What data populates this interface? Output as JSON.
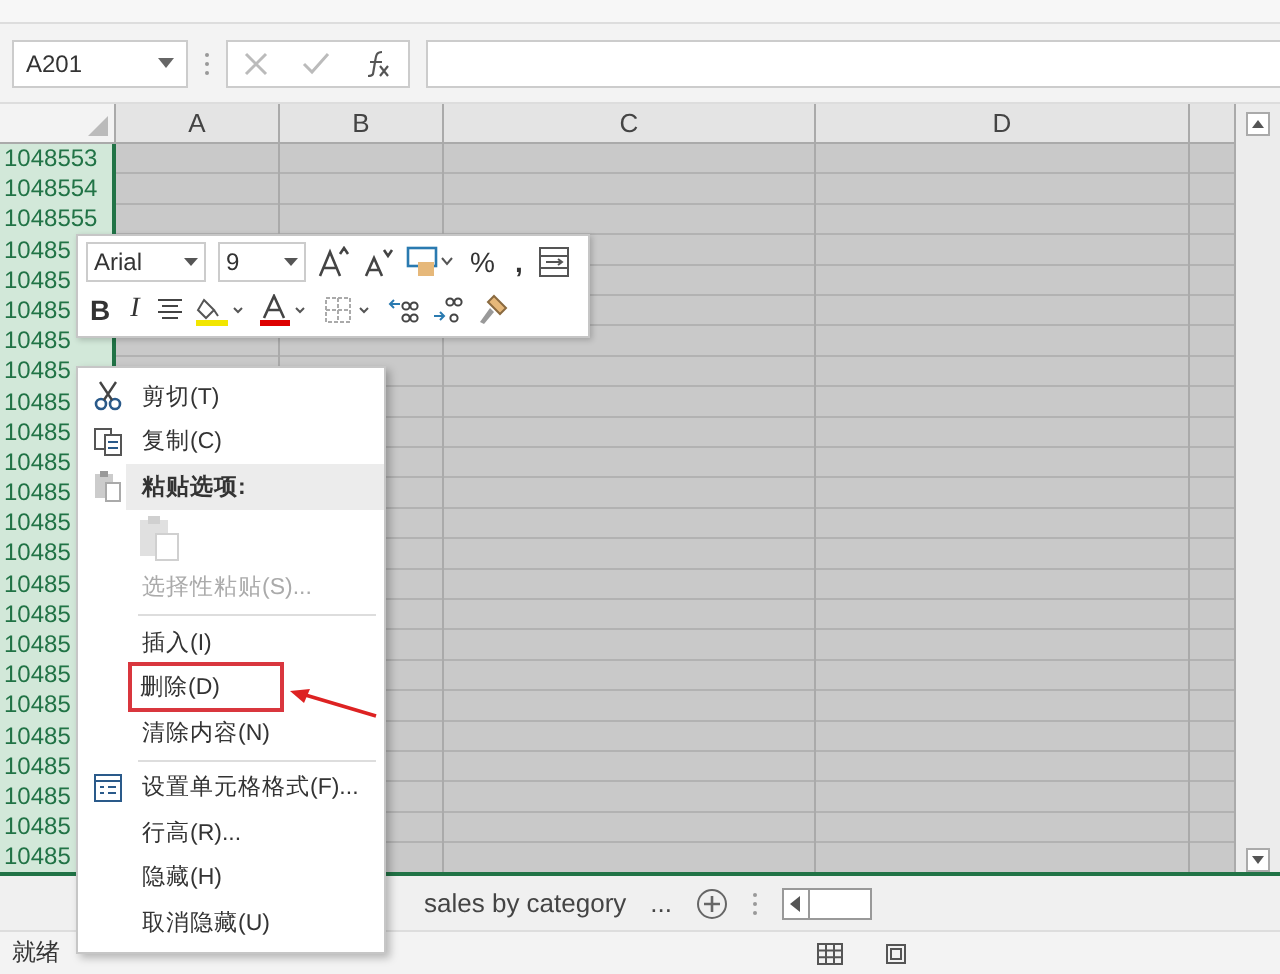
{
  "name_box": {
    "value": "A201"
  },
  "columns": [
    {
      "label": "A"
    },
    {
      "label": "B"
    },
    {
      "label": "C"
    },
    {
      "label": "D"
    }
  ],
  "rows": [
    {
      "header": "1048553",
      "selected": true
    },
    {
      "header": "1048554",
      "selected": true
    },
    {
      "header": "1048555",
      "selected": true
    },
    {
      "header": "10485",
      "selected": true
    },
    {
      "header": "10485",
      "selected": true
    },
    {
      "header": "10485",
      "selected": true
    },
    {
      "header": "10485",
      "selected": true
    },
    {
      "header": "10485",
      "selected": true
    },
    {
      "header": "10485",
      "selected": true
    },
    {
      "header": "10485",
      "selected": true
    },
    {
      "header": "10485",
      "selected": true
    },
    {
      "header": "10485",
      "selected": true
    },
    {
      "header": "10485",
      "selected": true
    },
    {
      "header": "10485",
      "selected": true
    },
    {
      "header": "10485",
      "selected": true
    },
    {
      "header": "10485",
      "selected": true
    },
    {
      "header": "10485",
      "selected": true
    },
    {
      "header": "10485",
      "selected": true
    },
    {
      "header": "10485",
      "selected": true
    },
    {
      "header": "10485",
      "selected": true
    },
    {
      "header": "10485",
      "selected": true
    },
    {
      "header": "10485",
      "selected": true
    },
    {
      "header": "10485",
      "selected": true
    },
    {
      "header": "10485",
      "selected": true
    }
  ],
  "mini_toolbar": {
    "font": "Arial",
    "size": "9",
    "percent": "%",
    "comma": ",",
    "bold": "B",
    "italic": "I"
  },
  "context_menu": {
    "items": [
      {
        "kind": "cut",
        "label": "剪切(T)",
        "disabled": false,
        "outlined": false
      },
      {
        "kind": "copy",
        "label": "复制(C)",
        "disabled": false,
        "outlined": false
      },
      {
        "kind": "header",
        "label": "粘贴选项:",
        "disabled": false,
        "outlined": false
      },
      {
        "kind": "paste-icons",
        "disabled": true
      },
      {
        "kind": "item",
        "label": "选择性粘贴(S)...",
        "disabled": true,
        "outlined": false
      },
      {
        "kind": "separator"
      },
      {
        "kind": "item",
        "label": "插入(I)",
        "disabled": false,
        "outlined": false
      },
      {
        "kind": "item",
        "label": "删除(D)",
        "disabled": false,
        "outlined": true
      },
      {
        "kind": "item",
        "label": "清除内容(N)",
        "disabled": false,
        "outlined": false
      },
      {
        "kind": "separator"
      },
      {
        "kind": "format",
        "label": "设置单元格格式(F)...",
        "disabled": false,
        "outlined": false
      },
      {
        "kind": "item",
        "label": "行高(R)...",
        "disabled": false,
        "outlined": false
      },
      {
        "kind": "item",
        "label": "隐藏(H)",
        "disabled": false,
        "outlined": false
      },
      {
        "kind": "item",
        "label": "取消隐藏(U)",
        "disabled": false,
        "outlined": false
      }
    ]
  },
  "sheet_tabs": {
    "tabs": [
      {
        "label": "sales by category"
      }
    ],
    "more": "..."
  },
  "status_bar": {
    "text": "就绪"
  }
}
